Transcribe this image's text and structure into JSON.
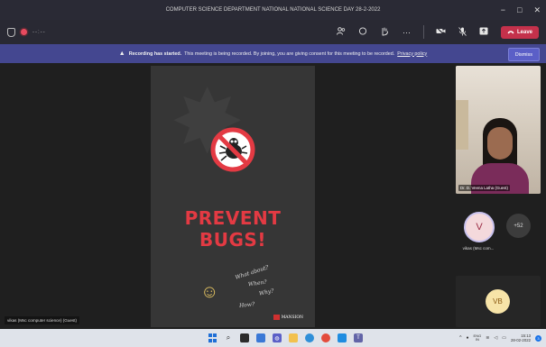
{
  "window": {
    "title": "COMPUTER SCIENCE DEPARTMENT NATIONAL NATIONAL SCIENCE DAY 28-2-2022",
    "minimize": "−",
    "maximize": "□",
    "close": "✕"
  },
  "toolbar": {
    "timer": "--:--",
    "leave_label": "Leave"
  },
  "banner": {
    "bold": "Recording has started.",
    "text": "This meeting is being recorded. By joining, you are giving consent for this meeting to be recorded.",
    "link": "Privacy policy",
    "dismiss": "Dismiss"
  },
  "slide": {
    "line1": "PREVENT",
    "line2": "BUGS!",
    "q1": "What about?",
    "q2": "When?",
    "q3": "Why?",
    "q4": "How?",
    "brand": "MANSION"
  },
  "presenter_label": "vikas (Msc computer science) (Guest)",
  "participants": {
    "video_name": "Dr. D. Veena Latha (Guest)",
    "v_initial": "V",
    "v_name": "vikas (Msc com...",
    "more_count": "+52",
    "vb_initial": "VB"
  },
  "taskbar": {
    "lang_line1": "ENG",
    "lang_line2": "IN",
    "time": "15:13",
    "date": "28-02-2022",
    "notifications": "3"
  }
}
